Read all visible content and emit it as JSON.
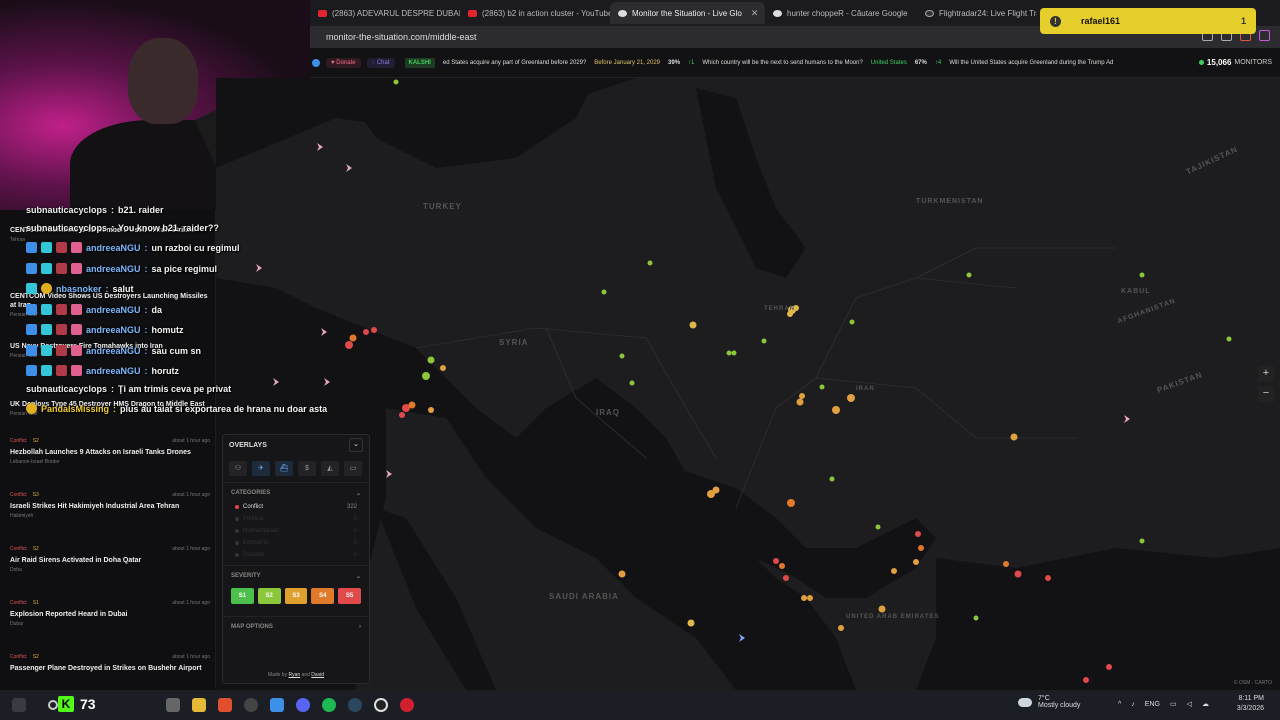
{
  "browser": {
    "tabs": [
      {
        "label": "(2863) ADEVARUL DESPRE DUBAI - Y",
        "icon": "youtube-icon"
      },
      {
        "label": "(2863) b2 in action cluster - YouTube",
        "icon": "youtube-icon"
      },
      {
        "label": "Monitor the Situation - Live Glo",
        "icon": "site-icon",
        "active": true
      },
      {
        "label": "hunter choppeR - Căutare Google",
        "icon": "google-icon"
      },
      {
        "label": "Flightradar24: Live Flight Tra",
        "icon": "flightradar-icon"
      }
    ],
    "address": "monitor-the-situation.com/middle-east"
  },
  "notification": {
    "user": "rafael161",
    "count": "1"
  },
  "header": {
    "donate_label": "Donate",
    "chat_label": "Chat",
    "kalshi_label": "KALSHI",
    "ticker": [
      {
        "question": "ed States acquire any part of Greenland before 2029?",
        "date": "Before January 21, 2029",
        "pct": "39%",
        "delta": "↑1"
      },
      {
        "question": "Which country will be the next to send humans to the Moon?",
        "answer": "United States",
        "pct": "67%",
        "delta": "↑4"
      },
      {
        "question": "Will the United States acquire Greenland during the Trump Ad"
      }
    ],
    "monitors_count": "15,066",
    "monitors_label": "MONITORS"
  },
  "map": {
    "labels": [
      "TURKEY",
      "SYRIA",
      "IRAQ",
      "SAUDI ARABIA",
      "PAKISTAN",
      "TAJIKISTAN",
      "TEHRAN",
      "KABUL",
      "UNITED ARAB EMIRATES",
      "IRAN",
      "AFGHANISTAN",
      "TURKMENISTAN"
    ],
    "zoom_in": "+",
    "zoom_out": "−",
    "attribution": "© OSM · CARTO"
  },
  "news": [
    {
      "category": "Conflict",
      "severity": "S2",
      "time": "about 1 hour ago",
      "title": "CENTCOM Confirms B-52 Bombers Used in Iran Strikes",
      "location": "Tehran"
    },
    {
      "category": "Conflict",
      "severity": "S3",
      "time": "about 1 hour ago",
      "title": "CENTCOM Video Shows US Destroyers Launching Missiles at Iran",
      "location": "Persian Gulf"
    },
    {
      "category": "Conflict",
      "severity": "S3",
      "time": "about 1 hour ago",
      "title": "US Navy Destroyers Fire Tomahawks into Iran",
      "location": "Persian Gulf"
    },
    {
      "category": "Conflict",
      "severity": "S2",
      "time": "about 1 hour ago",
      "title": "UK Deploys Type 45 Destroyer HMS Dragon to Middle East",
      "location": "Persian Gulf"
    },
    {
      "category": "Conflict",
      "severity": "S2",
      "time": "about 1 hour ago",
      "title": "Hezbollah Launches 9 Attacks on Israeli Tanks Drones",
      "location": "Lebanon-Israel Border"
    },
    {
      "category": "Conflict",
      "severity": "S3",
      "time": "about 1 hour ago",
      "title": "Israeli Strikes Hit Hakimiyeh Industrial Area Tehran",
      "location": "Hakimiyeh"
    },
    {
      "category": "Conflict",
      "severity": "S2",
      "time": "about 1 hour ago",
      "title": "Air Raid Sirens Activated in Doha Qatar",
      "location": "Doha"
    },
    {
      "category": "Conflict",
      "severity": "S1",
      "time": "about 1 hour ago",
      "title": "Explosion Reported Heard in Dubai",
      "location": "Dubai"
    },
    {
      "category": "Conflict",
      "severity": "S2",
      "time": "about 1 hour ago",
      "title": "Passenger Plane Destroyed in Strikes on Bushehr Airport",
      "location": ""
    }
  ],
  "chat": [
    {
      "user": "subnauticacyclops",
      "msg": "b21. raider",
      "badges": []
    },
    {
      "user": "subnauticacyclops",
      "msg": "You know b21. raider??",
      "badges": []
    },
    {
      "user": "andreeaNGU",
      "msg": "un razboi cu regimul",
      "badges": [
        "b-blue",
        "b-cyan",
        "b-red",
        "b-pink"
      ]
    },
    {
      "user": "andreeaNGU",
      "msg": "sa pice regimul",
      "badges": [
        "b-blue",
        "b-cyan",
        "b-red",
        "b-pink"
      ]
    },
    {
      "user": "nbasnoker",
      "msg": "salut",
      "badges": [
        "b-cyan",
        "b-yel"
      ]
    },
    {
      "user": "andreeaNGU",
      "msg": "da",
      "badges": [
        "b-blue",
        "b-cyan",
        "b-red",
        "b-pink"
      ]
    },
    {
      "user": "andreeaNGU",
      "msg": "homutz",
      "badges": [
        "b-blue",
        "b-cyan",
        "b-red",
        "b-pink"
      ]
    },
    {
      "user": "andreeaNGU",
      "msg": "sau cum sn",
      "badges": [
        "b-blue",
        "b-cyan",
        "b-red",
        "b-pink"
      ]
    },
    {
      "user": "andreeaNGU",
      "msg": "horutz",
      "badges": [
        "b-blue",
        "b-cyan",
        "b-red",
        "b-pink"
      ]
    },
    {
      "user": "subnauticacyclops",
      "msg": "Ţi am trimis ceva pe privat",
      "badges": []
    },
    {
      "user": "PandaIsMissing",
      "msg": "plus au taiat si exportarea de hrana nu doar asta",
      "badges": [
        "b-yel"
      ]
    }
  ],
  "panel": {
    "title": "OVERLAYS",
    "categories_title": "CATEGORIES",
    "categories": [
      {
        "label": "Conflict",
        "count": "322",
        "color": "#e04545"
      },
      {
        "label": "Political",
        "count": "0",
        "color": "#555"
      },
      {
        "label": "Humanitarian",
        "count": "0",
        "color": "#555"
      },
      {
        "label": "Economic",
        "count": "0",
        "color": "#555"
      },
      {
        "label": "Disaster",
        "count": "0",
        "color": "#555"
      }
    ],
    "severity_title": "SEVERITY",
    "severity": [
      {
        "label": "S1",
        "color": "#4cbf4c"
      },
      {
        "label": "S2",
        "color": "#8cc63a"
      },
      {
        "label": "S3",
        "color": "#e0a030"
      },
      {
        "label": "S4",
        "color": "#e07a2a"
      },
      {
        "label": "S5",
        "color": "#e04a4a"
      }
    ],
    "map_options_title": "MAP OPTIONS",
    "made_by": "Made by",
    "author1": "Ryan",
    "and": "and",
    "author2": "David"
  },
  "taskbar": {
    "kick_count": "73",
    "temp": "7°C",
    "weather": "Mostly cloudy",
    "lang": "ENG",
    "time": "8:11 PM",
    "date": "3/3/2026"
  }
}
